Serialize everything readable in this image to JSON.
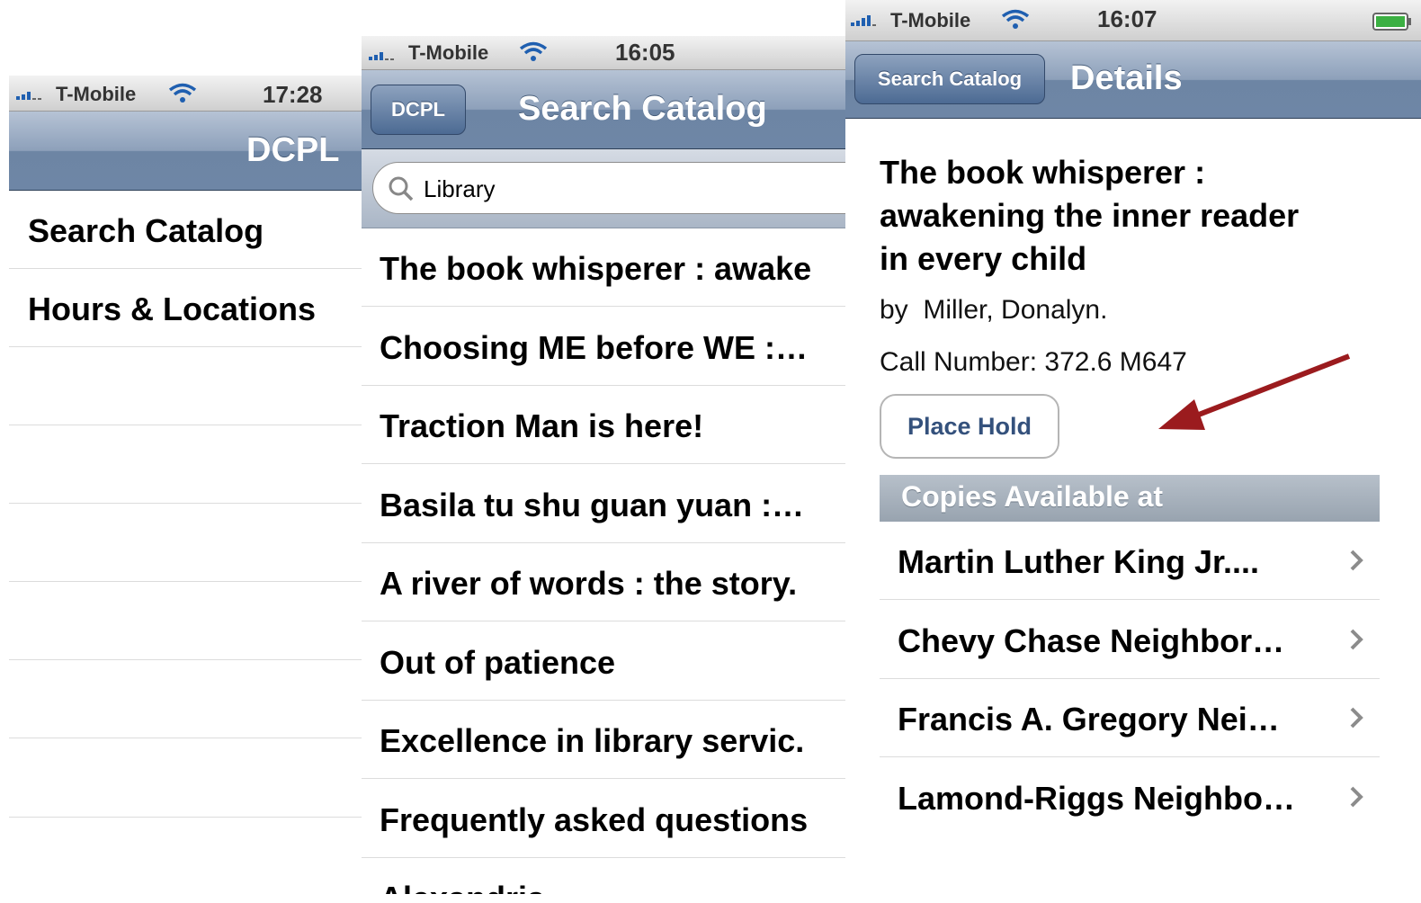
{
  "screen1": {
    "status": {
      "carrier": "T-Mobile",
      "time": "17:28",
      "signal_icon": "signal-bars-icon",
      "wifi_icon": "wifi-icon"
    },
    "nav_title": "DCPL",
    "menu": [
      "Search Catalog",
      "Hours & Locations"
    ]
  },
  "screen2": {
    "status": {
      "carrier": "T-Mobile",
      "time": "16:05"
    },
    "back_label": "DCPL",
    "nav_title": "Search Catalog",
    "search_value": "Library",
    "results": [
      "The book whisperer : awake",
      "Choosing ME before WE :…",
      "Traction Man is here!",
      "Basila tu shu guan yuan :…",
      "A river of words : the story.",
      "Out of patience",
      "Excellence in library servic.",
      "Frequently asked questions",
      "Alexandria"
    ]
  },
  "screen3": {
    "status": {
      "carrier": "T-Mobile",
      "time": "16:07",
      "battery_icon": "battery-icon"
    },
    "back_label": "Search Catalog",
    "nav_title": "Details",
    "book_title_lines": [
      "The book whisperer :",
      "awakening the inner reader",
      "in every child"
    ],
    "author": "by  Miller, Donalyn.",
    "call_number": "Call Number: 372.6 M647",
    "place_hold_label": "Place Hold",
    "copies_header": "Copies Available at",
    "branches": [
      "Martin Luther King Jr....",
      "Chevy Chase Neighbor…",
      "Francis A. Gregory Nei…",
      "Lamond-Riggs Neighbo…"
    ]
  },
  "colors": {
    "nav_blue": "#6d85a4",
    "annotation_arrow": "#9b1b1e",
    "section_header": "#a7b0ba"
  }
}
